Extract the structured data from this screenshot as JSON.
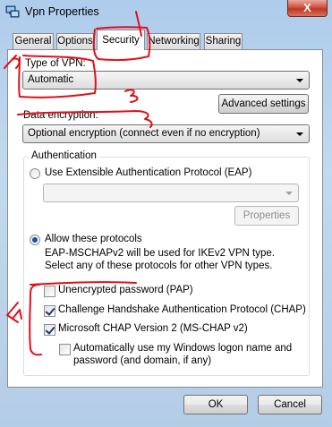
{
  "window": {
    "title": "Vpn Properties",
    "close_label": "X"
  },
  "tabs": [
    {
      "label": "General"
    },
    {
      "label": "Options"
    },
    {
      "label": "Security"
    },
    {
      "label": "Networking"
    },
    {
      "label": "Sharing"
    }
  ],
  "vpn_type": {
    "label": "Type of VPN:",
    "value": "Automatic"
  },
  "advanced_button": "Advanced settings",
  "encryption": {
    "label": "Data encryption:",
    "value": "Optional encryption (connect even if no encryption)"
  },
  "authentication": {
    "group_label": "Authentication",
    "eap_radio": "Use Extensible Authentication Protocol (EAP)",
    "eap_value": "",
    "properties_button": "Properties",
    "allow_radio": "Allow these protocols",
    "note": "EAP-MSCHAPv2 will be used for IKEv2 VPN type. Select any of these protocols for other VPN types.",
    "protocols": [
      {
        "label": "Unencrypted password (PAP)",
        "checked": false
      },
      {
        "label": "Challenge Handshake Authentication Protocol (CHAP)",
        "checked": true
      },
      {
        "label": "Microsoft CHAP Version 2 (MS-CHAP v2)",
        "checked": true
      }
    ],
    "auto_logon": "Automatically use my Windows logon name and password (and domain, if any)"
  },
  "footer": {
    "ok": "OK",
    "cancel": "Cancel"
  },
  "annotations": {
    "ink_color": "#e0101a",
    "marks": [
      "1",
      "2",
      "3",
      "4"
    ]
  }
}
